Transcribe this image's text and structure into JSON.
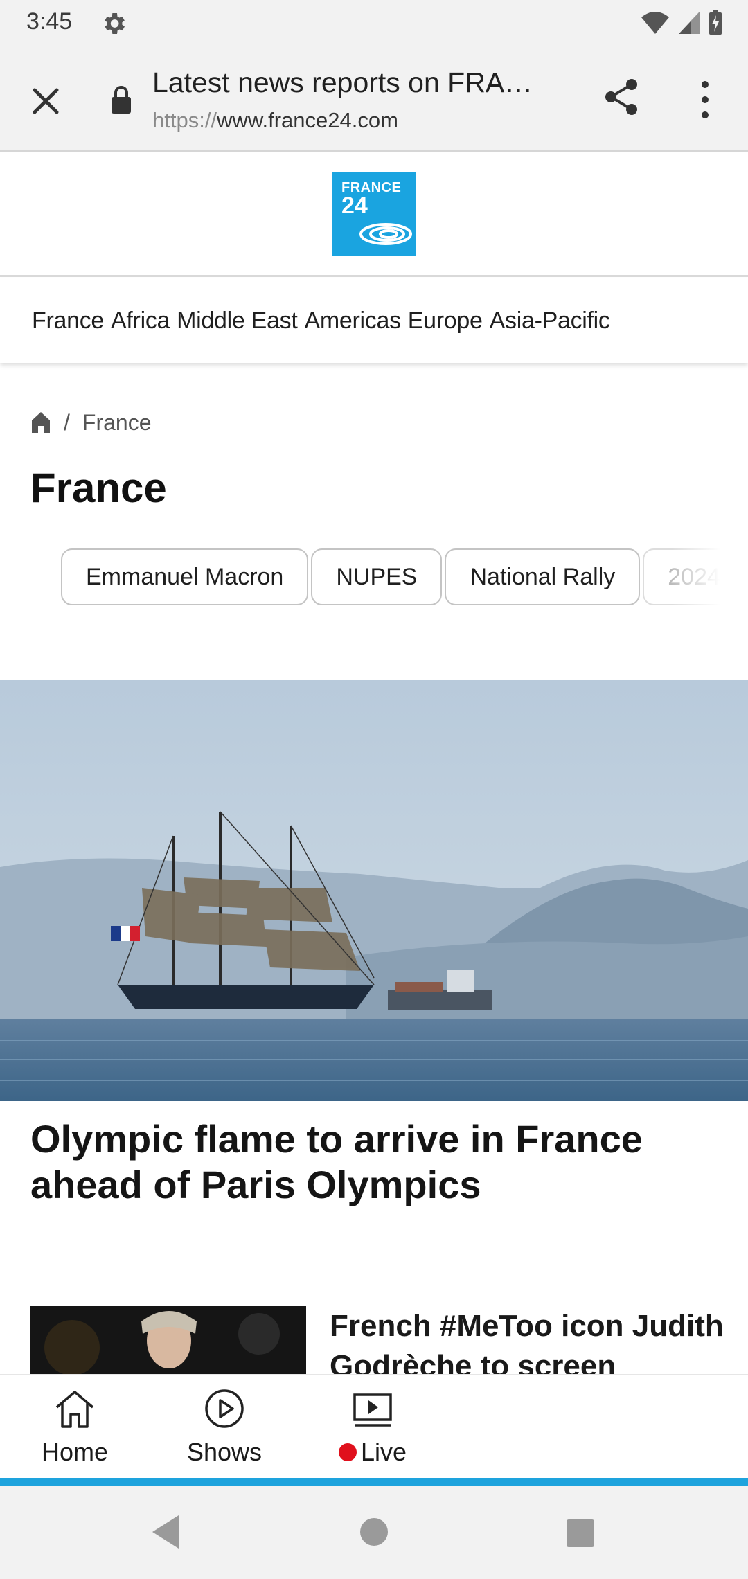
{
  "status_bar": {
    "time": "3:45",
    "icons": [
      "settings-gear-icon",
      "wifi-icon",
      "cellular-signal-icon",
      "battery-charging-icon"
    ]
  },
  "browser": {
    "page_title": "Latest news reports on FRA…",
    "url_scheme": "https://",
    "url_host": "www.france24.com",
    "icons": [
      "close-icon",
      "lock-icon",
      "share-icon",
      "more-vert-icon"
    ]
  },
  "site": {
    "logo_line1": "FRANCE",
    "logo_line2": "24",
    "brand_color": "#1aa4e0"
  },
  "regions": [
    "France",
    "Africa",
    "Middle East",
    "Americas",
    "Europe",
    "Asia-Pacific"
  ],
  "breadcrumb": {
    "separator": "/",
    "current": "France"
  },
  "page_title": "France",
  "tags": [
    "Emmanuel Macron",
    "NUPES",
    "National Rally",
    "2024"
  ],
  "hero": {
    "headline": "Olympic flame to arrive in France ahead of Paris Olympics"
  },
  "article2": {
    "headline": "French #MeToo icon Judith Godrèche to screen"
  },
  "bottom_nav": {
    "home": "Home",
    "shows": "Shows",
    "live": "Live",
    "live_dot_color": "#e0101c",
    "accent_bar_color": "#1ea3dd"
  }
}
